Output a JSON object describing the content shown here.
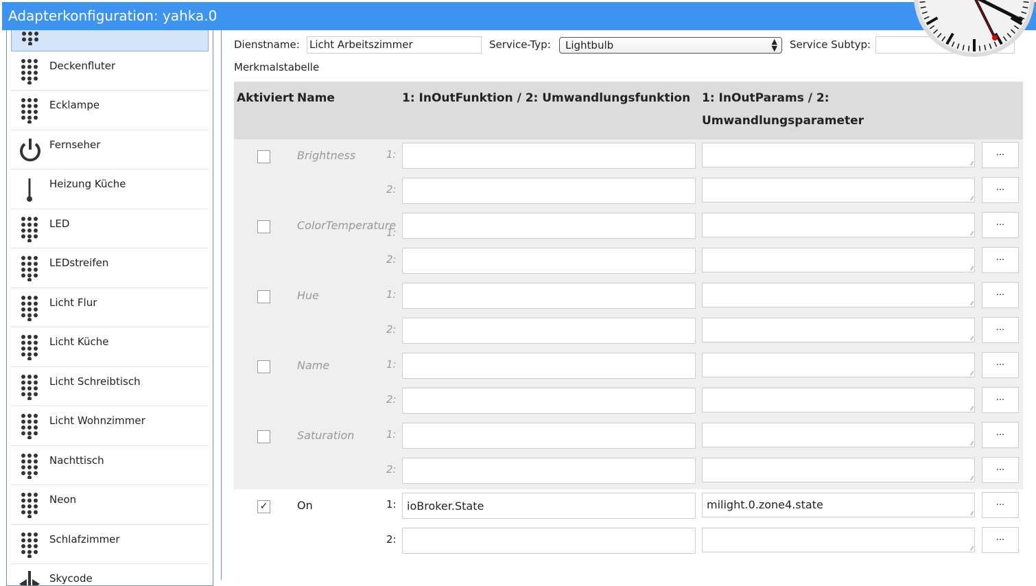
{
  "title": "Adapterkonfiguration: yahka.0",
  "sidebar": {
    "items": [
      {
        "label": "",
        "icon": "dots-icon",
        "selected": true
      },
      {
        "label": "Deckenfluter",
        "icon": "dots-icon"
      },
      {
        "label": "Ecklampe",
        "icon": "dots-icon"
      },
      {
        "label": "Fernseher",
        "icon": "power-icon"
      },
      {
        "label": "Heizung Küche",
        "icon": "thermometer-icon"
      },
      {
        "label": "LED",
        "icon": "dots-icon"
      },
      {
        "label": "LEDstreifen",
        "icon": "dots-icon"
      },
      {
        "label": "Licht Flur",
        "icon": "dots-icon"
      },
      {
        "label": "Licht Küche",
        "icon": "dots-icon"
      },
      {
        "label": "Licht Schreibtisch",
        "icon": "dots-icon"
      },
      {
        "label": "Licht Wohnzimmer",
        "icon": "dots-icon"
      },
      {
        "label": "Nachttisch",
        "icon": "dots-icon"
      },
      {
        "label": "Neon",
        "icon": "dots-icon"
      },
      {
        "label": "Schlafzimmer",
        "icon": "dots-icon"
      },
      {
        "label": "Skycode",
        "icon": "switch-icon"
      }
    ]
  },
  "form": {
    "service_name_label": "Dienstname:",
    "service_name": "Licht Arbeitszimmer",
    "service_type_label": "Service-Typ:",
    "service_type": "Lightbulb",
    "service_subtype_label": "Service Subtyp:",
    "service_subtype": "",
    "table_label": "Merkmalstabelle"
  },
  "table": {
    "headers": {
      "enabled": "Aktiviert",
      "name": "Name",
      "func": "1: InOutFunktion / 2: Umwandlungsfunktion",
      "params1": "1: InOutParams / 2:",
      "params2": "Umwandlungsparameter"
    },
    "rows": [
      {
        "name": "Brightness",
        "enabled": false,
        "f1": "",
        "p1": "",
        "f2": "",
        "p2": ""
      },
      {
        "name": "ColorTemperature",
        "enabled": false,
        "f1": "",
        "p1": "",
        "f2": "",
        "p2": ""
      },
      {
        "name": "Hue",
        "enabled": false,
        "f1": "",
        "p1": "",
        "f2": "",
        "p2": ""
      },
      {
        "name": "Name",
        "enabled": false,
        "f1": "",
        "p1": "",
        "f2": "",
        "p2": ""
      },
      {
        "name": "Saturation",
        "enabled": false,
        "f1": "",
        "p1": "",
        "f2": "",
        "p2": ""
      },
      {
        "name": "On",
        "enabled": true,
        "f1": "ioBroker.State",
        "p1": "milight.0.zone4.state",
        "f2": "",
        "p2": ""
      }
    ],
    "label1": "1:",
    "label2": "2:",
    "button": "...",
    "check": "✓"
  }
}
